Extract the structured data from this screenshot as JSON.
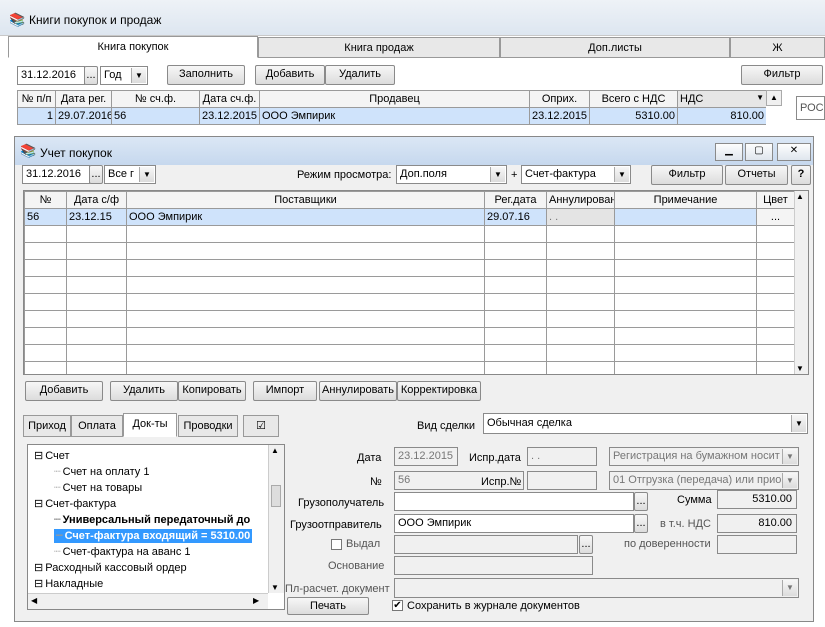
{
  "main_window": {
    "title": "Книги покупок и продаж",
    "tabs": [
      "Книга покупок",
      "Книга продаж",
      "Доп.листы",
      "Ж"
    ],
    "date": "31.12.2016",
    "period": "Год",
    "buttons": {
      "fill": "Заполнить",
      "add": "Добавить",
      "delete": "Удалить",
      "filter": "Фильтр"
    },
    "columns": [
      "№ п/п",
      "Дата рег.",
      "№ сч.ф.",
      "Дата сч.ф.",
      "Продавец",
      "Оприх.",
      "Всего с НДС",
      "НДС"
    ],
    "rows": [
      [
        "1",
        "29.07.2016",
        "56",
        "23.12.2015",
        "ООО Эмпирик",
        "23.12.2015",
        "5310.00",
        "810.00"
      ]
    ],
    "side_text": "РОС"
  },
  "sub_window": {
    "title": "Учет покупок",
    "date": "31.12.2016",
    "scope": "Все г",
    "view_mode_label": "Режим просмотра:",
    "view_mode": "Доп.поля",
    "plus": "+",
    "doc_type": "Счет-фактура",
    "buttons": {
      "filter": "Фильтр",
      "reports": "Отчеты",
      "help": "?"
    },
    "columns": [
      "№",
      "Дата с/ф",
      "Поставщики",
      "Рег.дата",
      "Аннулирован",
      "Примечание",
      "Цвет"
    ],
    "rows": [
      [
        "56",
        "23.12.15",
        "ООО Эмпирик",
        "29.07.16",
        ". .",
        "",
        "..."
      ]
    ],
    "actions": [
      "Добавить",
      "Удалить",
      "Копировать",
      "Импорт",
      "Аннулировать",
      "Корректировка"
    ],
    "lower_tabs": [
      "Приход",
      "Оплата",
      "Док-ты",
      "Проводки",
      "☑"
    ],
    "deal_type_label": "Вид сделки",
    "deal_type": "Обычная сделка",
    "tree": [
      {
        "label": "Счет",
        "level": 0,
        "style": "normal"
      },
      {
        "label": "Счет на оплату 1",
        "level": 1,
        "style": "normal"
      },
      {
        "label": "Счет на товары",
        "level": 1,
        "style": "normal"
      },
      {
        "label": "Счет-фактура",
        "level": 0,
        "style": "normal"
      },
      {
        "label": "Универсальный передаточный до",
        "level": 1,
        "style": "bold"
      },
      {
        "label": "Счет-фактура входящий = 5310.00",
        "level": 1,
        "style": "selected"
      },
      {
        "label": "Счет-фактура на аванс 1",
        "level": 1,
        "style": "normal"
      },
      {
        "label": "Расходный кассовый ордер",
        "level": 0,
        "style": "normal"
      },
      {
        "label": "Накладные",
        "level": 0,
        "style": "normal"
      }
    ],
    "form": {
      "date_label": "Дата",
      "date": "23.12.2015",
      "corr_date_label": "Испр.дата",
      "corr_date": ". .",
      "registration": "Регистрация на бумажном носит",
      "number_label": "№",
      "number": "56",
      "corr_no_label": "Испр.№",
      "corr_no": "",
      "shipment": "01 Отгрузка (передача) или прио",
      "consignee_label": "Грузополучатель",
      "consignee": "",
      "sum_label": "Сумма",
      "sum": "5310.00",
      "shipper_label": "Грузоотправитель",
      "shipper": "ООО Эмпирик",
      "vat_label": "в т.ч. НДС",
      "vat": "810.00",
      "issued_label": "Выдал",
      "issued": "",
      "power_of_attorney_label": "по доверенности",
      "power_of_attorney": "",
      "basis_label": "Основание",
      "basis": "",
      "payment_doc_label": "Пл-расчет. документ",
      "payment_doc": "",
      "print_button": "Печать",
      "save_journal_label": "Сохранить в журнале документов"
    }
  },
  "colors": {
    "selection": "#cfe3fb",
    "tree_selected": "#3399ff",
    "window_bg": "#f0f0f0"
  }
}
